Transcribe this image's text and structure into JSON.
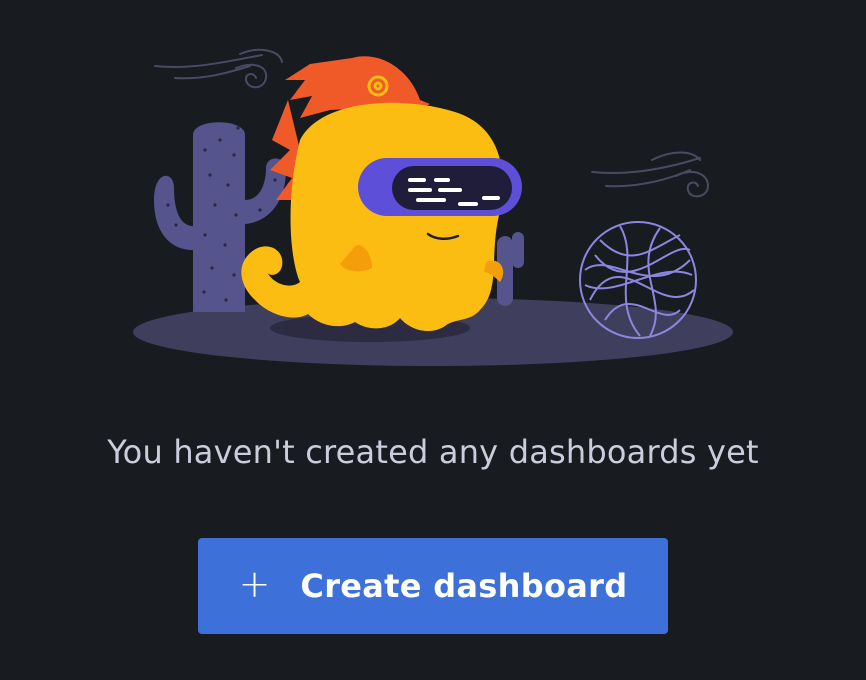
{
  "empty_state": {
    "message": "You haven't created any dashboards yet",
    "illustration_icon": "grafana-mascot-desert-illustration"
  },
  "actions": {
    "create_dashboard": {
      "icon": "plus-icon",
      "icon_glyph": "+",
      "label": "Create dashboard"
    }
  },
  "colors": {
    "background": "#181b1f",
    "text": "#ccccdc",
    "button": "#3d71d9",
    "mascot_body": "#fbbd12",
    "mascot_crest": "#f05a28",
    "visor": "#5d4fd8",
    "cactus": "#56548c",
    "ground": "#3f3e5c",
    "tumbleweed": "#8d86e0"
  }
}
